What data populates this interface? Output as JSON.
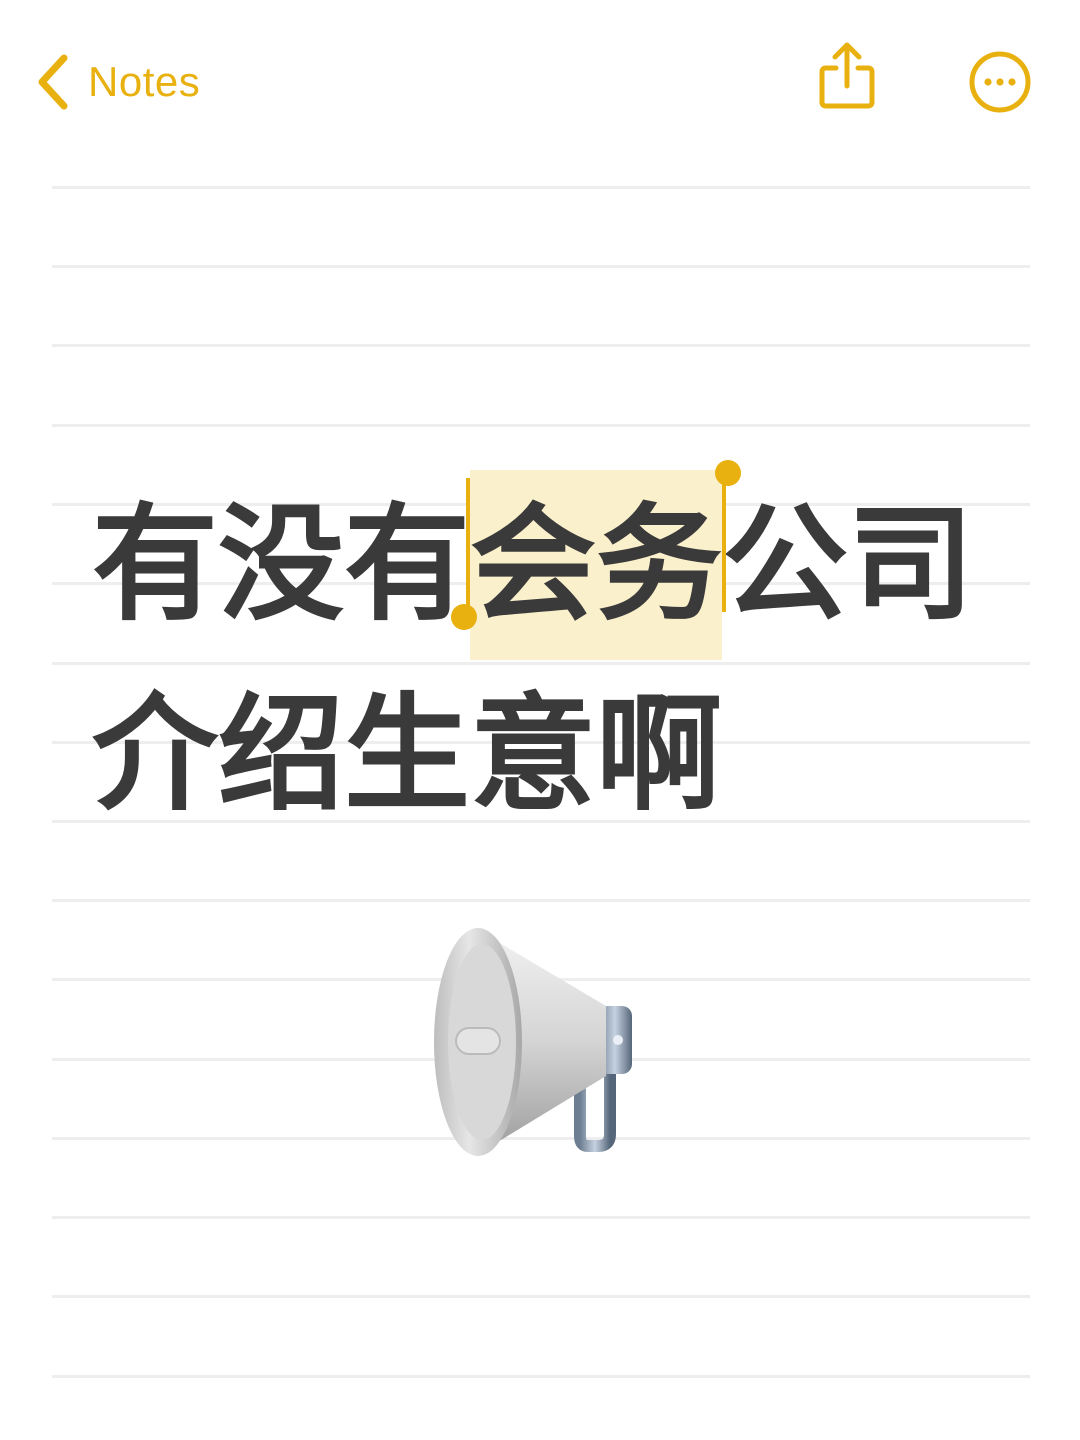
{
  "nav": {
    "back_label": "Notes",
    "accent_color": "#E8B10F",
    "icons": {
      "back": "chevron-left-icon",
      "share": "share-icon",
      "more": "ellipsis-circle-icon"
    }
  },
  "note": {
    "line1_before": "有没有",
    "line1_selected": "会务",
    "line1_after": "公司",
    "line2": "介绍生意啊",
    "selection_color": "#FBF0CC"
  },
  "illustration": "megaphone-icon"
}
